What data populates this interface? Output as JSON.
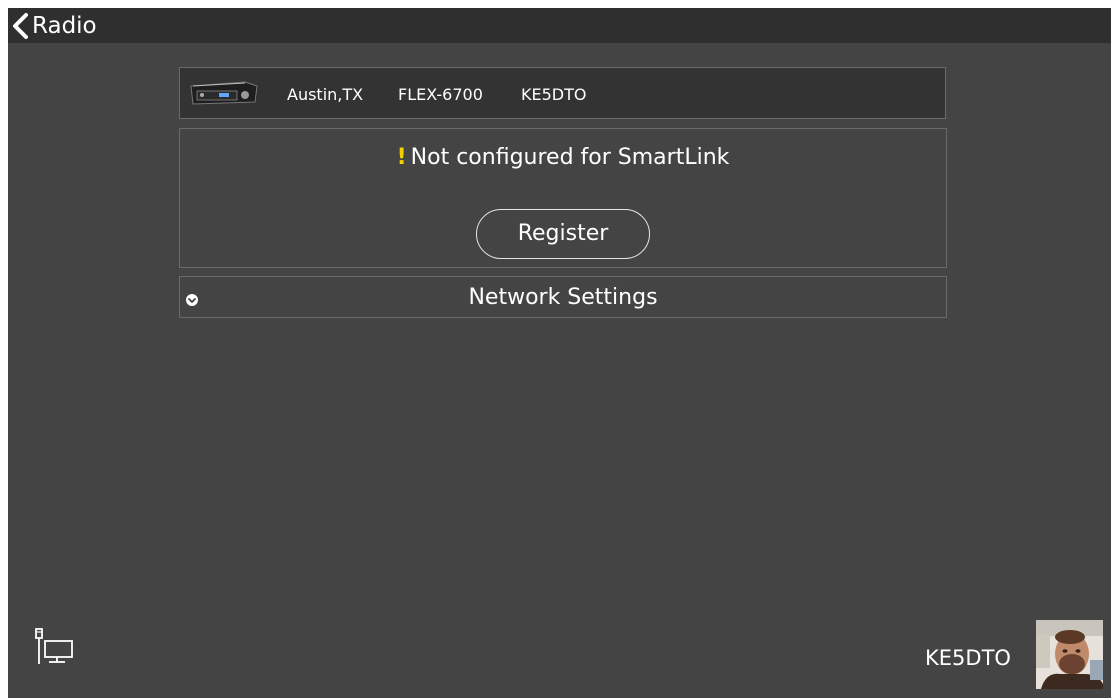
{
  "header": {
    "back_label": "Radio"
  },
  "radio": {
    "location": "Austin,TX",
    "model": "FLEX-6700",
    "callsign": "KE5DTO"
  },
  "smartlink": {
    "status_text": "Not configured for SmartLink",
    "warning_glyph": "!",
    "register_label": "Register"
  },
  "network": {
    "label": "Network Settings"
  },
  "user": {
    "callsign": "KE5DTO"
  },
  "colors": {
    "background": "#444444",
    "titlebar": "#2f2f2f",
    "card": "#333333",
    "border": "#6a6a6a",
    "warning": "#f4d000",
    "text": "#ffffff"
  },
  "icons": {
    "back": "chevron-left-icon",
    "network_settings": "chevron-down-circle-icon",
    "network_status": "wired-network-icon"
  }
}
